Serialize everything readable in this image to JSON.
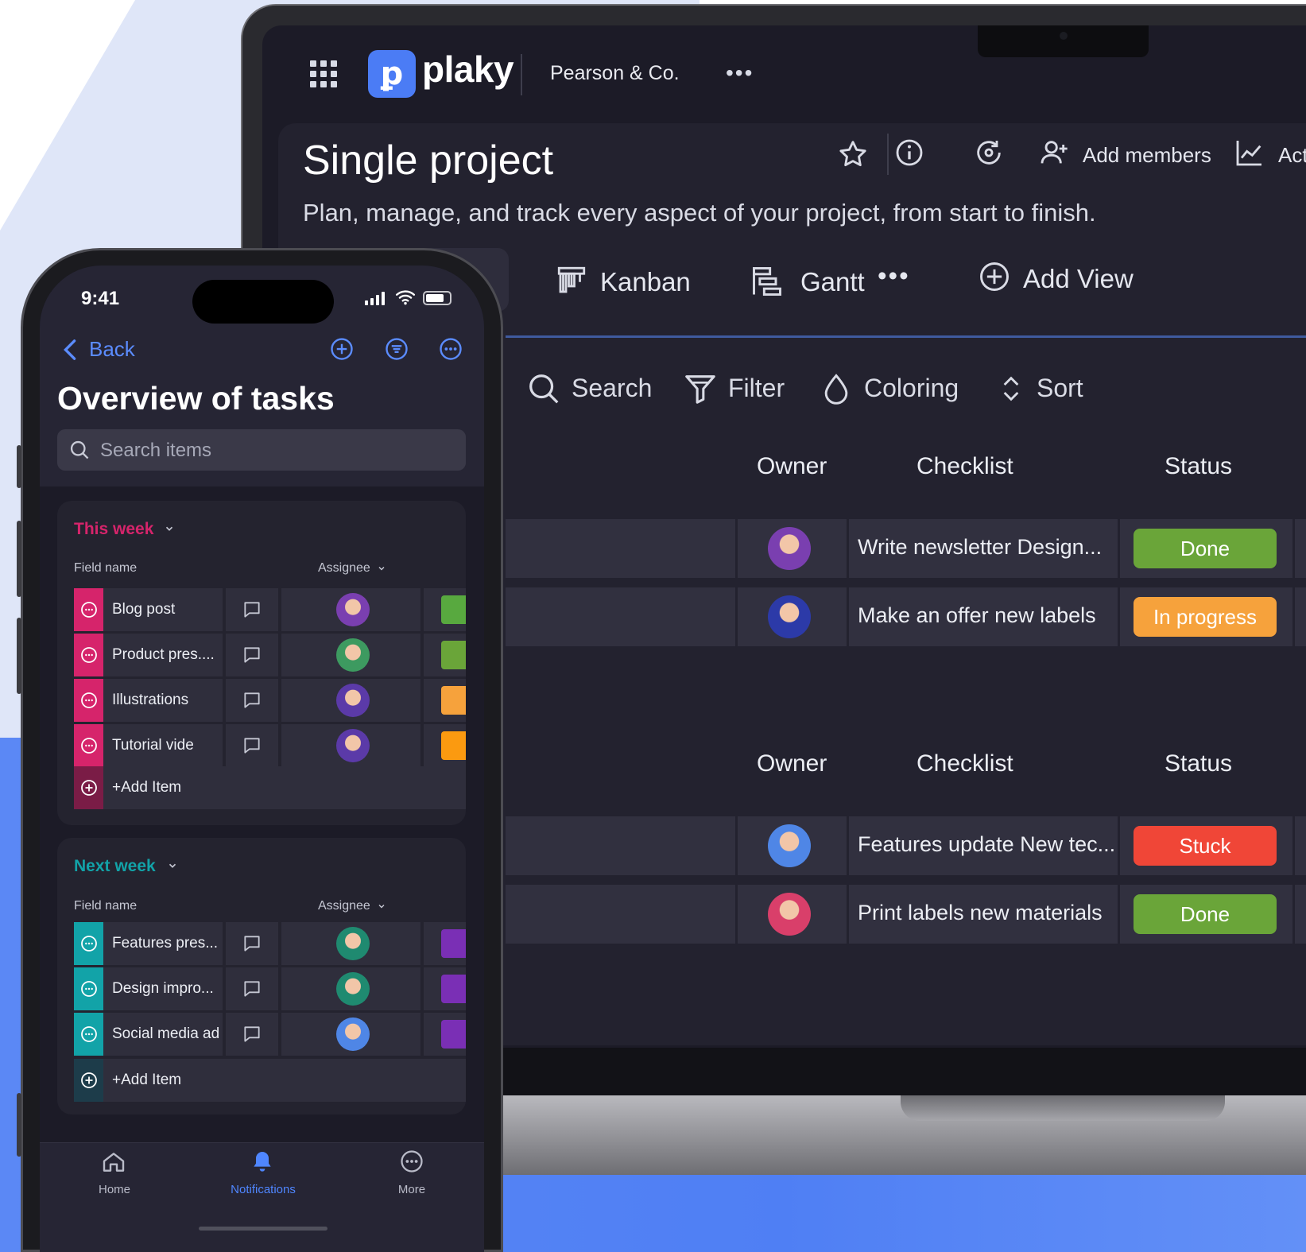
{
  "laptop": {
    "logo_text": "plaky",
    "workspace": "Pearson & Co.",
    "project_title": "Single project",
    "project_description": "Plan, manage, and track every aspect of your project, from start to finish.",
    "add_members_label": "Add members",
    "activity_label": "Act",
    "view_tabs": [
      {
        "label": "Kanban",
        "icon": "kanban-icon"
      },
      {
        "label": "Gantt",
        "icon": "gantt-icon"
      }
    ],
    "add_view_label": "Add View",
    "toolbar": {
      "search": "Search",
      "filter": "Filter",
      "coloring": "Coloring",
      "sort": "Sort"
    },
    "columns": {
      "owner": "Owner",
      "checklist": "Checklist",
      "status": "Status"
    },
    "group1_rows": [
      {
        "checklist": "Write newsletter Design...",
        "status": "Done",
        "status_color": "#6aa539",
        "avatar_color": "#7a3fb0"
      },
      {
        "checklist": "Make an offer new labels",
        "status": "In progress",
        "status_color": "#f6a23c",
        "avatar_color": "#2c3aa8"
      }
    ],
    "group2_rows": [
      {
        "checklist": "Features update New tec...",
        "status": "Stuck",
        "status_color": "#f04637",
        "avatar_color": "#4f86e6"
      },
      {
        "checklist": "Print labels new materials",
        "status": "Done",
        "status_color": "#6aa539",
        "avatar_color": "#d93f6a"
      }
    ]
  },
  "phone": {
    "time": "9:41",
    "back_label": "Back",
    "title": "Overview of tasks",
    "search_placeholder": "Search items",
    "field_name_label": "Field name",
    "assignee_label": "Assignee",
    "add_item_label": "+Add Item",
    "groups": [
      {
        "title": "This week",
        "color": "#d6246b",
        "items": [
          {
            "name": "Blog post",
            "chip": "#58a93f",
            "avatar": "#7a3fb0"
          },
          {
            "name": "Product pres....",
            "chip": "#6aa539",
            "avatar": "#3d9a60"
          },
          {
            "name": "Illustrations",
            "chip": "#f6a23c",
            "avatar": "#5b3aa8"
          },
          {
            "name": "Tutorial vide",
            "chip": "#fb9a10",
            "avatar": "#5b3aa8"
          }
        ]
      },
      {
        "title": "Next week",
        "color": "#12a3a8",
        "items": [
          {
            "name": "Features pres...",
            "chip": "#7a2fb5",
            "avatar": "#1f8a70"
          },
          {
            "name": "Design impro...",
            "chip": "#7a2fb5",
            "avatar": "#1f8a70"
          },
          {
            "name": "Social media ad",
            "chip": "#7a2fb5",
            "avatar": "#4f86e6"
          }
        ]
      }
    ],
    "tabbar": [
      {
        "label": "Home",
        "icon": "home-icon",
        "active": false
      },
      {
        "label": "Notifications",
        "icon": "bell-icon",
        "active": true
      },
      {
        "label": "More",
        "icon": "more-circle-icon",
        "active": false
      }
    ],
    "accent_color": "#4f86ff"
  }
}
